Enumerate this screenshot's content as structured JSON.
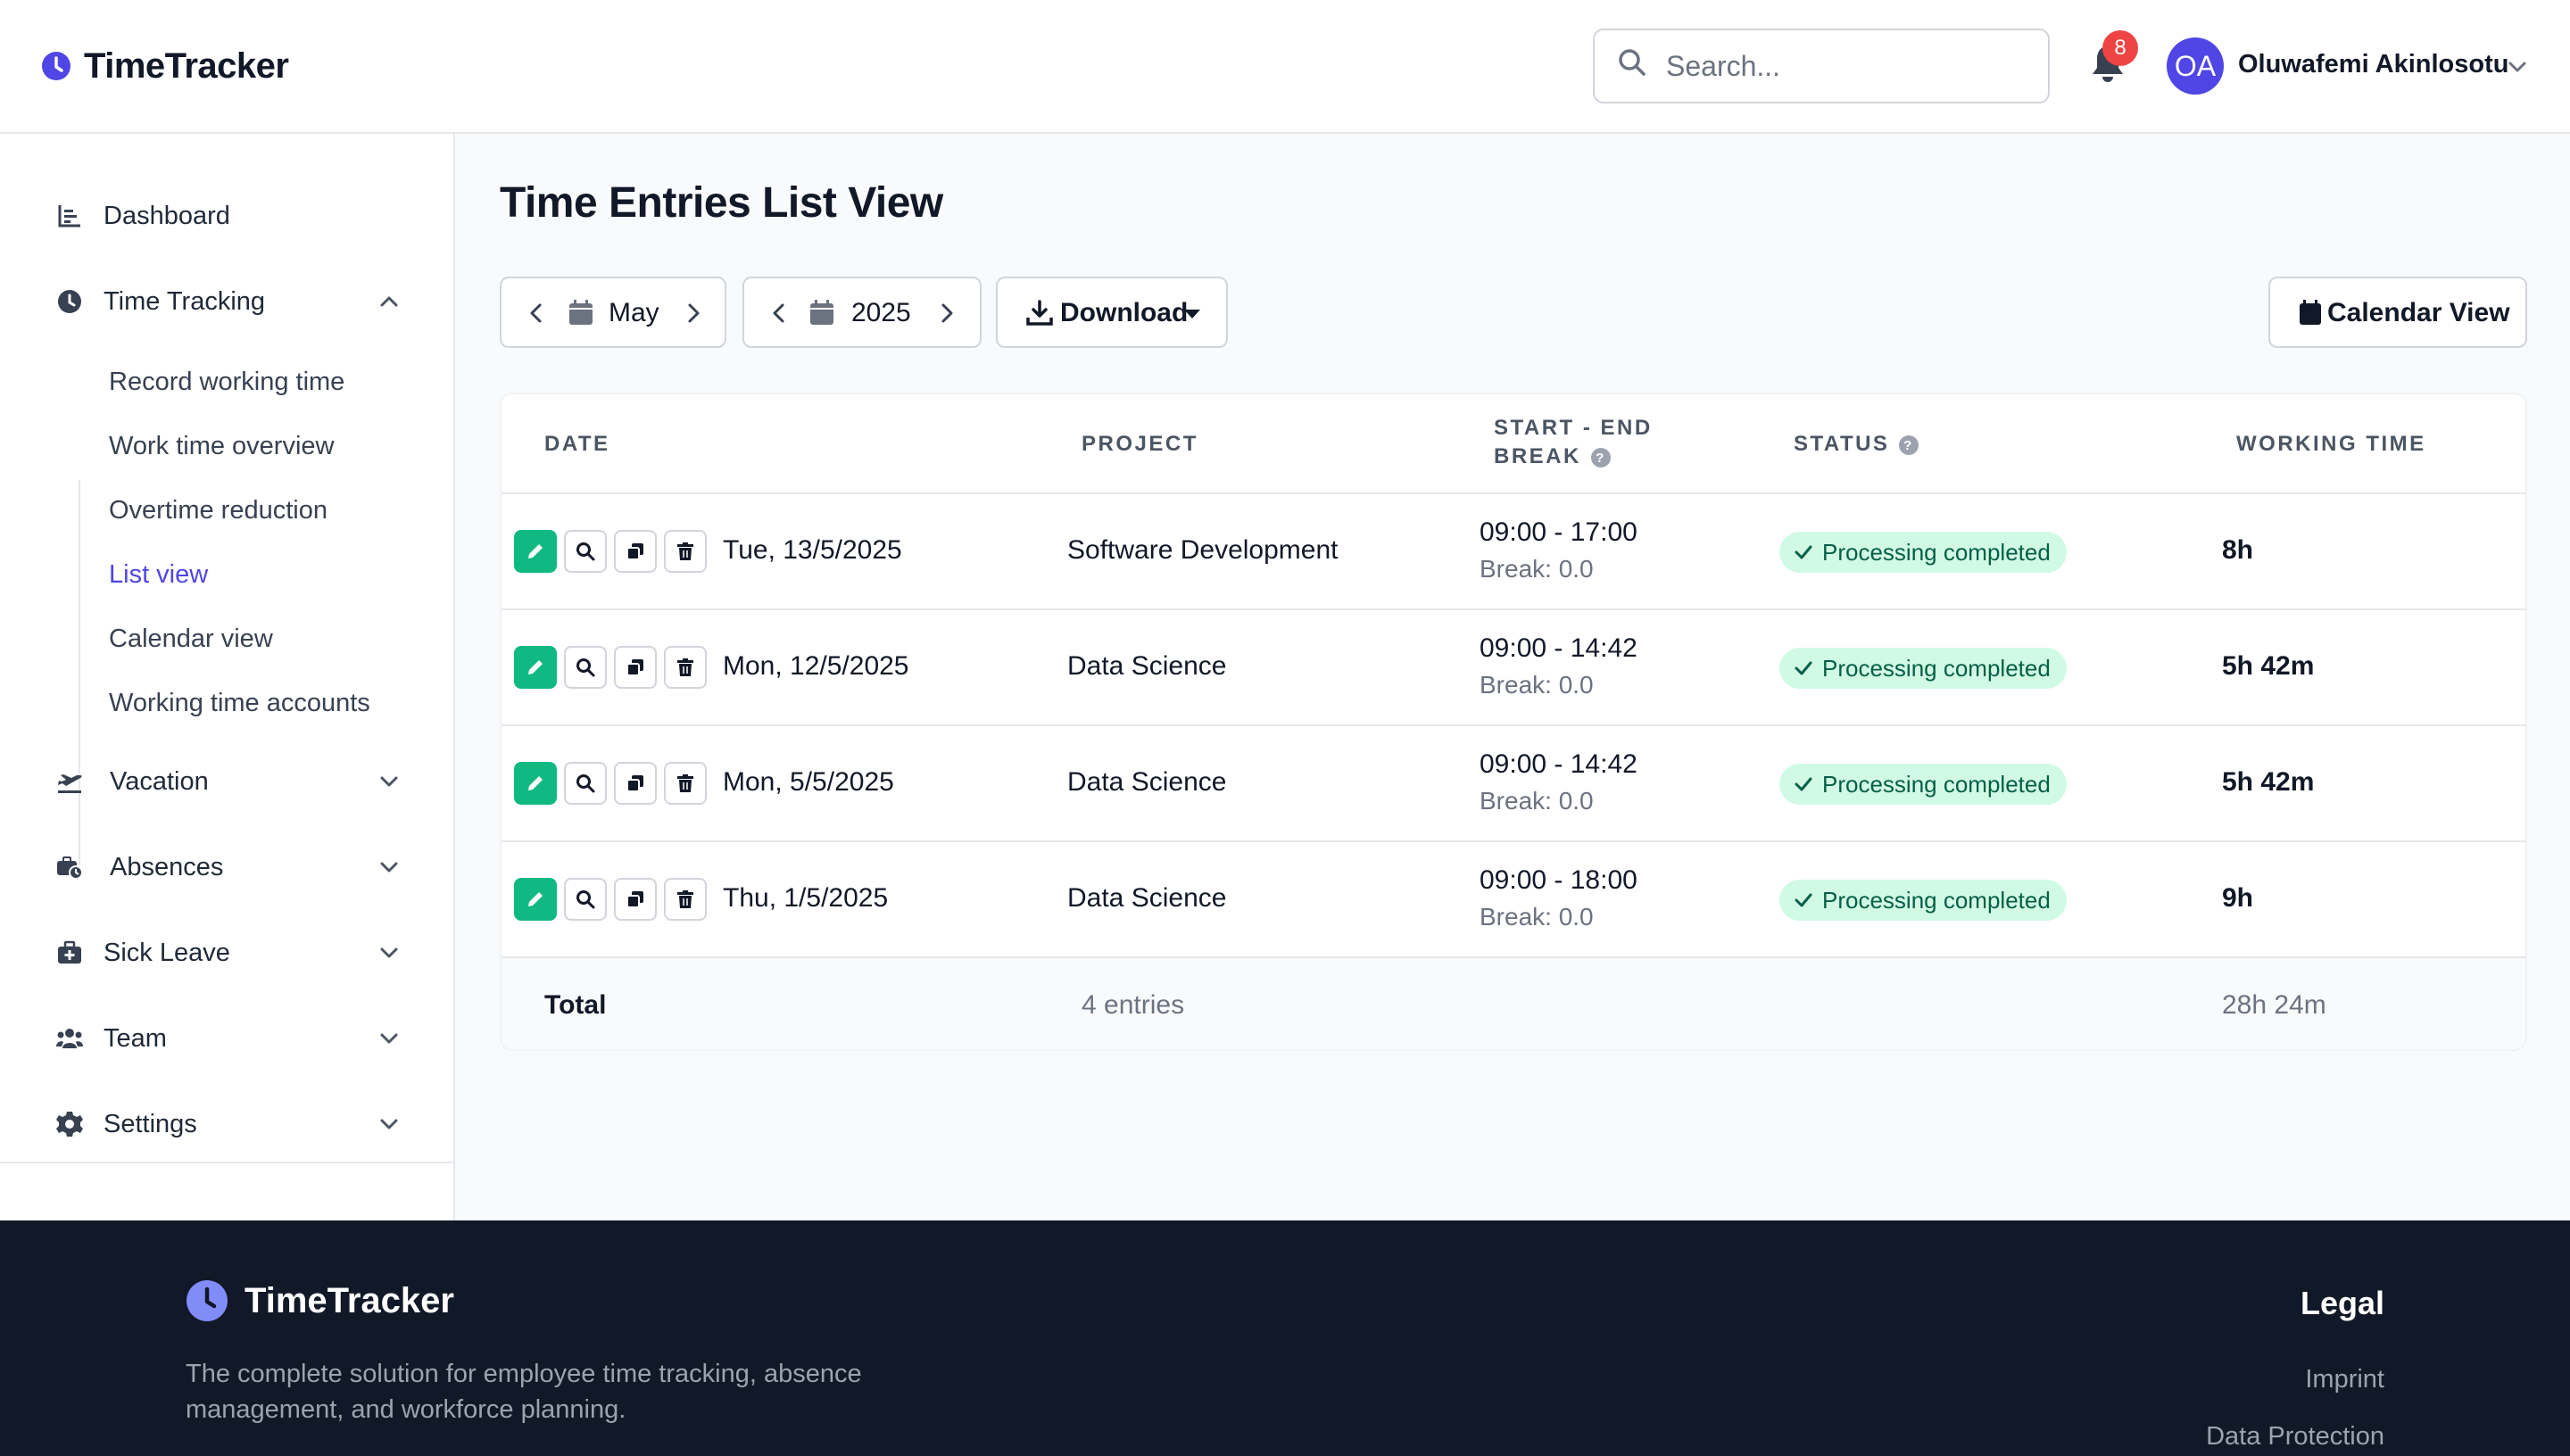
{
  "app": {
    "name": "TimeTracker"
  },
  "header": {
    "search_placeholder": "Search...",
    "notification_count": "8",
    "user": {
      "initials": "OA",
      "name": "Oluwafemi Akinlosotu"
    }
  },
  "sidebar": {
    "items": [
      {
        "label": "Dashboard",
        "icon": "chart-bar-icon"
      },
      {
        "label": "Time Tracking",
        "icon": "clock-icon",
        "expanded": true
      },
      {
        "label": "Vacation",
        "icon": "plane-icon"
      },
      {
        "label": "Absences",
        "icon": "briefcase-clock-icon"
      },
      {
        "label": "Sick Leave",
        "icon": "medical-kit-icon"
      },
      {
        "label": "Team",
        "icon": "users-icon"
      },
      {
        "label": "Settings",
        "icon": "gear-icon"
      }
    ],
    "time_tracking_subitems": [
      {
        "label": "Record working time"
      },
      {
        "label": "Work time overview"
      },
      {
        "label": "Overtime reduction"
      },
      {
        "label": "List view",
        "active": true
      },
      {
        "label": "Calendar view"
      },
      {
        "label": "Working time accounts"
      }
    ]
  },
  "main": {
    "title": "Time Entries List View",
    "month_label": "May",
    "year_label": "2025",
    "download_label": "Download",
    "calendar_view_label": "Calendar View",
    "table": {
      "headers": {
        "date": "DATE",
        "project": "PROJECT",
        "time_line1": "START - END",
        "time_line2": "BREAK",
        "status": "STATUS",
        "working_time": "WORKING TIME"
      },
      "rows": [
        {
          "date": "Tue, 13/5/2025",
          "project": "Software Development",
          "time": "09:00 - 17:00",
          "break": "Break: 0.0",
          "status": "Processing completed",
          "working_time": "8h"
        },
        {
          "date": "Mon, 12/5/2025",
          "project": "Data Science",
          "time": "09:00 - 14:42",
          "break": "Break: 0.0",
          "status": "Processing completed",
          "working_time": "5h 42m"
        },
        {
          "date": "Mon, 5/5/2025",
          "project": "Data Science",
          "time": "09:00 - 14:42",
          "break": "Break: 0.0",
          "status": "Processing completed",
          "working_time": "5h 42m"
        },
        {
          "date": "Thu, 1/5/2025",
          "project": "Data Science",
          "time": "09:00 - 18:00",
          "break": "Break: 0.0",
          "status": "Processing completed",
          "working_time": "9h"
        }
      ],
      "footer": {
        "label": "Total",
        "entries": "4 entries",
        "total_time": "28h 24m"
      }
    }
  },
  "footer": {
    "brand": "TimeTracker",
    "description": "The complete solution for employee time tracking, absence management, and workforce planning.",
    "legal_heading": "Legal",
    "links": [
      "Imprint",
      "Data Protection"
    ]
  },
  "colors": {
    "accent": "#4f46e5",
    "success": "#10b981",
    "badge_bg": "#d1fae5",
    "badge_text": "#065f46",
    "footer_bg": "#111827",
    "notification": "#ef4444"
  }
}
